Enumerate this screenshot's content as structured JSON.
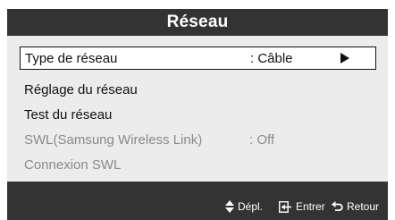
{
  "window": {
    "title": "Réseau"
  },
  "menu": {
    "items": [
      {
        "label": "Type de réseau",
        "value": ": Câble",
        "selected": true,
        "enabled": true,
        "has_submenu": true
      },
      {
        "label": "Réglage du réseau",
        "value": "",
        "selected": false,
        "enabled": true
      },
      {
        "label": "Test du réseau",
        "value": "",
        "selected": false,
        "enabled": true
      },
      {
        "label": "SWL(Samsung Wireless Link)",
        "value": ": Off",
        "selected": false,
        "enabled": false
      },
      {
        "label": "Connexion SWL",
        "value": "",
        "selected": false,
        "enabled": false
      }
    ]
  },
  "footer": {
    "hints": [
      {
        "icon": "up-down-arrow-icon",
        "label": "Dépl."
      },
      {
        "icon": "enter-icon",
        "label": "Entrer"
      },
      {
        "icon": "return-icon",
        "label": "Retour"
      }
    ]
  },
  "colors": {
    "title_bar": "#333333",
    "panel_background": "#ececec",
    "text": "#111111",
    "disabled_text": "#8a8a8a",
    "footer": "#333333"
  }
}
